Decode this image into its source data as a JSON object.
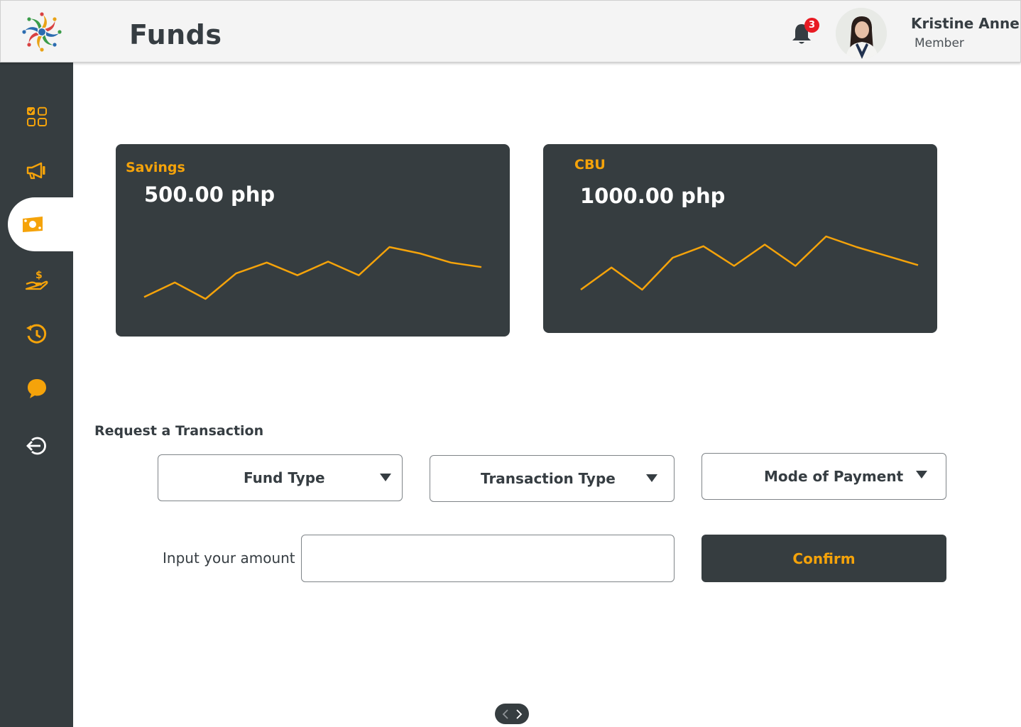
{
  "header": {
    "title": "Funds",
    "notification_count": "3",
    "user_name": "Kristine Anne",
    "user_role": "Member"
  },
  "sidebar": {
    "items": [
      {
        "icon": "dashboard-icon",
        "active": false
      },
      {
        "icon": "megaphone-icon",
        "active": false
      },
      {
        "icon": "money-icon",
        "active": true
      },
      {
        "icon": "loan-hand-icon",
        "active": false
      },
      {
        "icon": "history-icon",
        "active": false
      },
      {
        "icon": "chat-icon",
        "active": false
      },
      {
        "icon": "logout-icon",
        "active": false
      }
    ]
  },
  "cards": [
    {
      "label": "Savings",
      "amount": "500.00 php",
      "trend": [
        4,
        20,
        2,
        30,
        42,
        28,
        43,
        28,
        59,
        52,
        42,
        37
      ]
    },
    {
      "label": "CBU",
      "amount": "1000.00 php",
      "trend": [
        3,
        30,
        3,
        42,
        56,
        32,
        58,
        32,
        68,
        55,
        44,
        33
      ]
    }
  ],
  "form": {
    "section_title": "Request a Transaction",
    "fund_type": "Fund Type",
    "transaction_type": "Transaction Type",
    "mode_of_payment": "Mode of Payment",
    "amount_label": "Input your amount",
    "amount_value": "",
    "confirm_label": "Confirm"
  },
  "colors": {
    "accent": "#f5a30a",
    "dark": "#363d40",
    "badge": "#e81b23"
  }
}
